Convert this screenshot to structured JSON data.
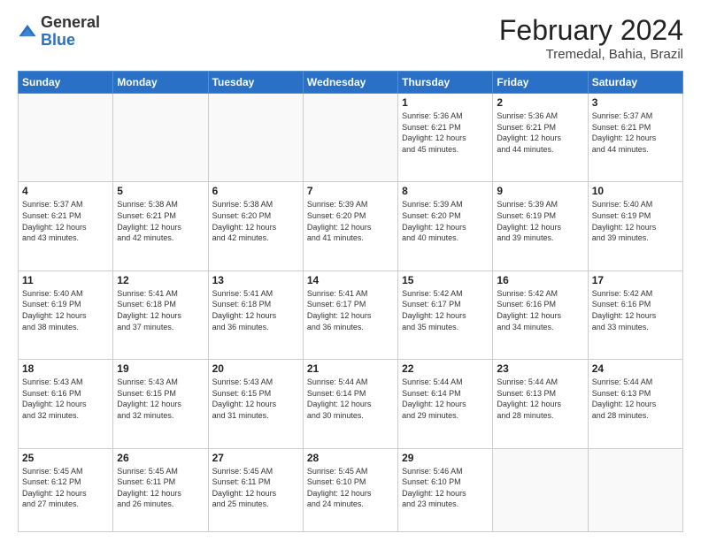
{
  "header": {
    "logo_general": "General",
    "logo_blue": "Blue",
    "title": "February 2024",
    "subtitle": "Tremedal, Bahia, Brazil"
  },
  "weekdays": [
    "Sunday",
    "Monday",
    "Tuesday",
    "Wednesday",
    "Thursday",
    "Friday",
    "Saturday"
  ],
  "weeks": [
    [
      {
        "day": "",
        "info": ""
      },
      {
        "day": "",
        "info": ""
      },
      {
        "day": "",
        "info": ""
      },
      {
        "day": "",
        "info": ""
      },
      {
        "day": "1",
        "info": "Sunrise: 5:36 AM\nSunset: 6:21 PM\nDaylight: 12 hours\nand 45 minutes."
      },
      {
        "day": "2",
        "info": "Sunrise: 5:36 AM\nSunset: 6:21 PM\nDaylight: 12 hours\nand 44 minutes."
      },
      {
        "day": "3",
        "info": "Sunrise: 5:37 AM\nSunset: 6:21 PM\nDaylight: 12 hours\nand 44 minutes."
      }
    ],
    [
      {
        "day": "4",
        "info": "Sunrise: 5:37 AM\nSunset: 6:21 PM\nDaylight: 12 hours\nand 43 minutes."
      },
      {
        "day": "5",
        "info": "Sunrise: 5:38 AM\nSunset: 6:21 PM\nDaylight: 12 hours\nand 42 minutes."
      },
      {
        "day": "6",
        "info": "Sunrise: 5:38 AM\nSunset: 6:20 PM\nDaylight: 12 hours\nand 42 minutes."
      },
      {
        "day": "7",
        "info": "Sunrise: 5:39 AM\nSunset: 6:20 PM\nDaylight: 12 hours\nand 41 minutes."
      },
      {
        "day": "8",
        "info": "Sunrise: 5:39 AM\nSunset: 6:20 PM\nDaylight: 12 hours\nand 40 minutes."
      },
      {
        "day": "9",
        "info": "Sunrise: 5:39 AM\nSunset: 6:19 PM\nDaylight: 12 hours\nand 39 minutes."
      },
      {
        "day": "10",
        "info": "Sunrise: 5:40 AM\nSunset: 6:19 PM\nDaylight: 12 hours\nand 39 minutes."
      }
    ],
    [
      {
        "day": "11",
        "info": "Sunrise: 5:40 AM\nSunset: 6:19 PM\nDaylight: 12 hours\nand 38 minutes."
      },
      {
        "day": "12",
        "info": "Sunrise: 5:41 AM\nSunset: 6:18 PM\nDaylight: 12 hours\nand 37 minutes."
      },
      {
        "day": "13",
        "info": "Sunrise: 5:41 AM\nSunset: 6:18 PM\nDaylight: 12 hours\nand 36 minutes."
      },
      {
        "day": "14",
        "info": "Sunrise: 5:41 AM\nSunset: 6:17 PM\nDaylight: 12 hours\nand 36 minutes."
      },
      {
        "day": "15",
        "info": "Sunrise: 5:42 AM\nSunset: 6:17 PM\nDaylight: 12 hours\nand 35 minutes."
      },
      {
        "day": "16",
        "info": "Sunrise: 5:42 AM\nSunset: 6:16 PM\nDaylight: 12 hours\nand 34 minutes."
      },
      {
        "day": "17",
        "info": "Sunrise: 5:42 AM\nSunset: 6:16 PM\nDaylight: 12 hours\nand 33 minutes."
      }
    ],
    [
      {
        "day": "18",
        "info": "Sunrise: 5:43 AM\nSunset: 6:16 PM\nDaylight: 12 hours\nand 32 minutes."
      },
      {
        "day": "19",
        "info": "Sunrise: 5:43 AM\nSunset: 6:15 PM\nDaylight: 12 hours\nand 32 minutes."
      },
      {
        "day": "20",
        "info": "Sunrise: 5:43 AM\nSunset: 6:15 PM\nDaylight: 12 hours\nand 31 minutes."
      },
      {
        "day": "21",
        "info": "Sunrise: 5:44 AM\nSunset: 6:14 PM\nDaylight: 12 hours\nand 30 minutes."
      },
      {
        "day": "22",
        "info": "Sunrise: 5:44 AM\nSunset: 6:14 PM\nDaylight: 12 hours\nand 29 minutes."
      },
      {
        "day": "23",
        "info": "Sunrise: 5:44 AM\nSunset: 6:13 PM\nDaylight: 12 hours\nand 28 minutes."
      },
      {
        "day": "24",
        "info": "Sunrise: 5:44 AM\nSunset: 6:13 PM\nDaylight: 12 hours\nand 28 minutes."
      }
    ],
    [
      {
        "day": "25",
        "info": "Sunrise: 5:45 AM\nSunset: 6:12 PM\nDaylight: 12 hours\nand 27 minutes."
      },
      {
        "day": "26",
        "info": "Sunrise: 5:45 AM\nSunset: 6:11 PM\nDaylight: 12 hours\nand 26 minutes."
      },
      {
        "day": "27",
        "info": "Sunrise: 5:45 AM\nSunset: 6:11 PM\nDaylight: 12 hours\nand 25 minutes."
      },
      {
        "day": "28",
        "info": "Sunrise: 5:45 AM\nSunset: 6:10 PM\nDaylight: 12 hours\nand 24 minutes."
      },
      {
        "day": "29",
        "info": "Sunrise: 5:46 AM\nSunset: 6:10 PM\nDaylight: 12 hours\nand 23 minutes."
      },
      {
        "day": "",
        "info": ""
      },
      {
        "day": "",
        "info": ""
      }
    ]
  ]
}
